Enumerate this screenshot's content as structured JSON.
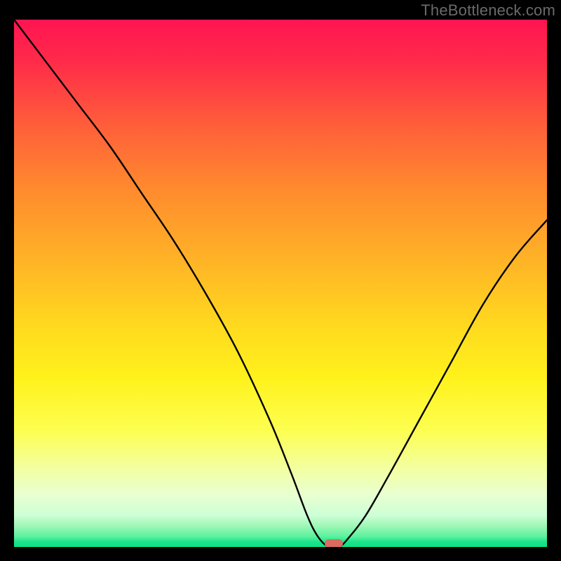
{
  "watermark": "TheBottleneck.com",
  "chart_data": {
    "type": "line",
    "title": "",
    "xlabel": "",
    "ylabel": "",
    "xlim": [
      0,
      100
    ],
    "ylim": [
      0,
      100
    ],
    "grid": false,
    "legend": false,
    "series": [
      {
        "name": "bottleneck-curve",
        "x": [
          0,
          6,
          12,
          18,
          24,
          30,
          36,
          42,
          48,
          52,
          55,
          57,
          59,
          61,
          63,
          66,
          70,
          76,
          82,
          88,
          94,
          100
        ],
        "y": [
          100,
          92,
          84,
          76,
          67,
          58,
          48,
          37,
          24,
          14,
          6,
          2,
          0,
          0,
          2,
          6,
          13,
          24,
          35,
          46,
          55,
          62
        ]
      }
    ],
    "minimum_marker": {
      "x": 60,
      "y": 0,
      "color": "#d96b60"
    },
    "background_gradient": {
      "top": "#ff1452",
      "mid": "#ffe21c",
      "bottom": "#0ce087"
    }
  }
}
